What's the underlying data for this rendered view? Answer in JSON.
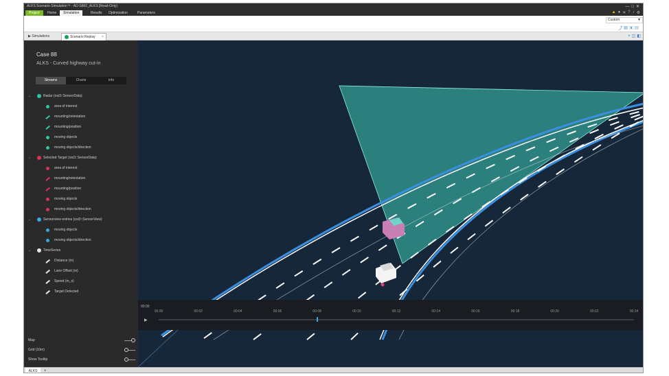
{
  "app": {
    "title": "ALKS Scenario Simulation™ - AD-SIM2_ALKS [Read-Only]",
    "ribbon_tabs": [
      "Project",
      "Home",
      "Simulation",
      "Results",
      "Optimization",
      "Parameters"
    ],
    "active_ribbon_tab": "Simulation",
    "custom_select_value": "Custom",
    "quick_icons": [
      "warning-icon",
      "user-icon",
      "close-icon",
      "help-icon",
      "sound-icon",
      "settings-icon"
    ]
  },
  "doc_tabs": {
    "simulations": "Simulations",
    "replay": "Scenario Replay"
  },
  "left_panel": {
    "case_title": "Case 88",
    "case_subtitle": "ALKS - Curved highway cut-in",
    "tabs": [
      "Streams",
      "Charts",
      "Info"
    ],
    "active_tab": "Streams",
    "groups": [
      {
        "label": "Radar (osi3::SensorData)",
        "color": "#2ec4a6",
        "items": [
          "area of interest",
          "mounting/orientation",
          "mounting/position",
          "moving objects",
          "moving objects/direction"
        ]
      },
      {
        "label": "Selected Target (osi3::SensorData)",
        "color": "#d9325a",
        "items": [
          "area of interest",
          "mounting/orientation",
          "mounting/position",
          "moving objects",
          "moving objects/direction"
        ]
      },
      {
        "label": "Sensorview entries (osi3::SensorView)",
        "color": "#3aa8e0",
        "items": [
          "moving objects",
          "moving objects/direction"
        ]
      },
      {
        "label": "TimeSeries",
        "color": "#e6e6e6",
        "items": [
          "Distance (m)",
          "Lane Offset (m)",
          "Speed (m_s)",
          "Target Detected"
        ]
      }
    ],
    "toggles": [
      {
        "label": "Map",
        "on": true
      },
      {
        "label": "Grid (10m)",
        "on": false
      },
      {
        "label": "Show Tooltip",
        "on": false
      }
    ]
  },
  "timeline": {
    "current": "00:00",
    "labels": [
      "00:00",
      "00:02",
      "00:04",
      "00:06",
      "00:08",
      "00:10",
      "00:12",
      "00:14",
      "00:16",
      "00:18",
      "00:20",
      "00:22",
      "00:24"
    ],
    "cursor_time": "00:08"
  },
  "bottom_bar": {
    "tab": "ALKS",
    "add": "+"
  }
}
